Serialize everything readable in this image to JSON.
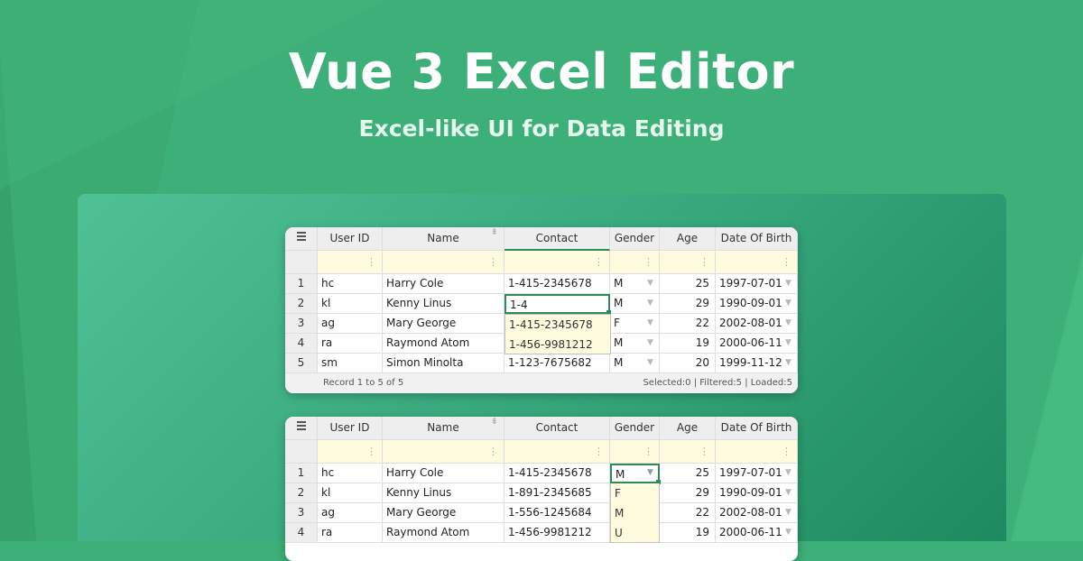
{
  "hero": {
    "title": "Vue 3 Excel Editor",
    "subtitle": "Excel-like UI for Data Editing"
  },
  "columns": [
    "User ID",
    "Name",
    "Contact",
    "Gender",
    "Age",
    "Date Of Birth"
  ],
  "sheet1": {
    "rows": [
      {
        "n": "1",
        "id": "hc",
        "name": "Harry Cole",
        "contact": "1-415-2345678",
        "gender": "M",
        "age": "25",
        "dob": "1997-07-01"
      },
      {
        "n": "2",
        "id": "kl",
        "name": "Kenny Linus",
        "contact": "1-4",
        "gender": "M",
        "age": "29",
        "dob": "1990-09-01"
      },
      {
        "n": "3",
        "id": "ag",
        "name": "Mary George",
        "contact": "",
        "gender": "F",
        "age": "22",
        "dob": "2002-08-01"
      },
      {
        "n": "4",
        "id": "ra",
        "name": "Raymond Atom",
        "contact": "",
        "gender": "M",
        "age": "19",
        "dob": "2000-06-11"
      },
      {
        "n": "5",
        "id": "sm",
        "name": "Simon Minolta",
        "contact": "1-123-7675682",
        "gender": "M",
        "age": "20",
        "dob": "1999-11-12"
      }
    ],
    "autocomplete": [
      "1-415-2345678",
      "1-456-9981212"
    ],
    "footer_left": "Record 1 to 5 of 5",
    "footer_right": "Selected:0 | Filtered:5 | Loaded:5"
  },
  "sheet2": {
    "rows": [
      {
        "n": "1",
        "id": "hc",
        "name": "Harry Cole",
        "contact": "1-415-2345678",
        "gender": "M",
        "age": "25",
        "dob": "1997-07-01"
      },
      {
        "n": "2",
        "id": "kl",
        "name": "Kenny Linus",
        "contact": "1-891-2345685",
        "gender": "",
        "age": "29",
        "dob": "1990-09-01"
      },
      {
        "n": "3",
        "id": "ag",
        "name": "Mary George",
        "contact": "1-556-1245684",
        "gender": "",
        "age": "22",
        "dob": "2002-08-01"
      },
      {
        "n": "4",
        "id": "ra",
        "name": "Raymond Atom",
        "contact": "1-456-9981212",
        "gender": "",
        "age": "19",
        "dob": "2000-06-11"
      }
    ],
    "gender_options": [
      "F",
      "M",
      "U"
    ]
  },
  "icons": {
    "menu": "menu-icon",
    "filter": "filter-menu-icon",
    "dropdown": "dropdown-triangle-icon",
    "sort": "sort-pin-icon"
  },
  "colors": {
    "background": "#3daf78",
    "panel": "#35a57a",
    "filter_row": "#fffbdf",
    "accent": "#2e8b57"
  }
}
